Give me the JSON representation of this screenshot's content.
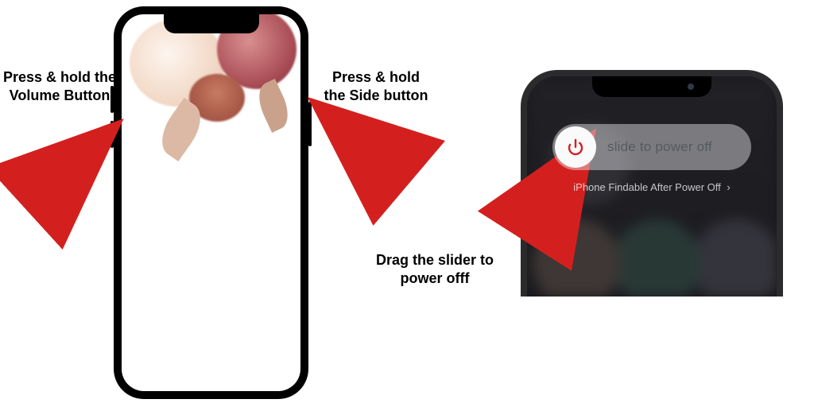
{
  "annotations": {
    "volume": "Press & hold the Volume Button",
    "side": "Press & hold the Side button",
    "drag": "Drag the slider to power offf"
  },
  "power_off_screen": {
    "slider_label": "slide to power off",
    "findable_label": "iPhone Findable After Power Off",
    "chevron": "›"
  },
  "colors": {
    "arrow": "#d3201f"
  },
  "icons": {
    "power": "power-icon"
  }
}
